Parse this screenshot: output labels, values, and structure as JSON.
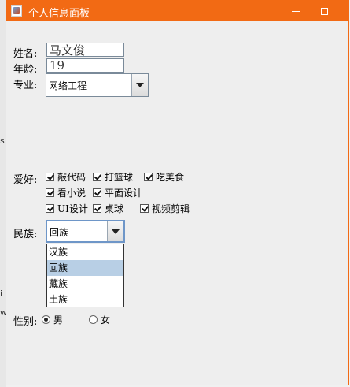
{
  "window": {
    "title": "个人信息面板"
  },
  "form": {
    "name_label": "姓名:",
    "name_value": "马文俊",
    "age_label": "年龄:",
    "age_value": "19",
    "major_label": "专业:",
    "major_value": "网络工程",
    "hobby_label": "爱好:",
    "hobbies": [
      {
        "label": "敲代码",
        "checked": true
      },
      {
        "label": "打篮球",
        "checked": true
      },
      {
        "label": "吃美食",
        "checked": true
      },
      {
        "label": "看小说",
        "checked": true
      },
      {
        "label": "平面设计",
        "checked": true
      },
      {
        "label": "UI设计",
        "checked": true
      },
      {
        "label": "桌球",
        "checked": true
      },
      {
        "label": "视频剪辑",
        "checked": true
      }
    ],
    "ethnic_label": "民族:",
    "ethnic_value": "回族",
    "ethnic_options": [
      "汉族",
      "回族",
      "藏族",
      "土族"
    ],
    "ethnic_selected_index": 1,
    "gender_label": "性别:",
    "gender_options": [
      {
        "label": "男",
        "selected": true
      },
      {
        "label": "女",
        "selected": false
      }
    ]
  },
  "background": {
    "fragments": [
      "s",
      "i",
      "w"
    ]
  }
}
